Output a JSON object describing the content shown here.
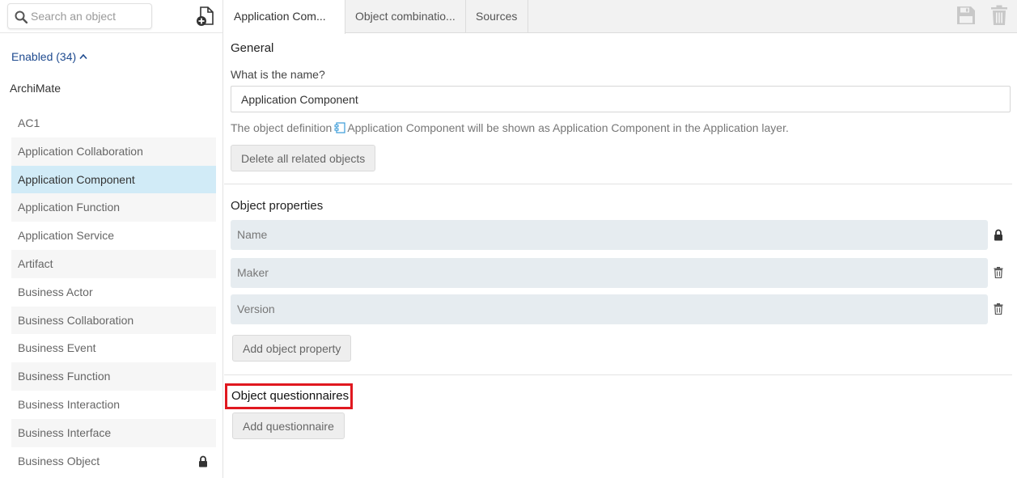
{
  "sidebar": {
    "search_placeholder": "Search an object",
    "enabled_label": "Enabled (34)",
    "group_title": "ArchiMate",
    "items": [
      {
        "label": "AC1"
      },
      {
        "label": "Application Collaboration"
      },
      {
        "label": "Application Component",
        "selected": true
      },
      {
        "label": "Application Function"
      },
      {
        "label": "Application Service"
      },
      {
        "label": "Artifact"
      },
      {
        "label": "Business Actor"
      },
      {
        "label": "Business Collaboration"
      },
      {
        "label": "Business Event"
      },
      {
        "label": "Business Function"
      },
      {
        "label": "Business Interaction"
      },
      {
        "label": "Business Interface"
      },
      {
        "label": "Business Object",
        "locked": true
      }
    ]
  },
  "tabs": [
    {
      "label": "Application Com...",
      "active": true
    },
    {
      "label": "Object combinatio..."
    },
    {
      "label": "Sources"
    }
  ],
  "general": {
    "title": "General",
    "name_question": "What is the name?",
    "name_value": "Application Component",
    "definition_prefix": "The object definition",
    "definition_suffix": "Application Component will be shown as Application Component in the Application layer.",
    "delete_related_label": "Delete all related objects"
  },
  "properties": {
    "title": "Object properties",
    "rows": [
      {
        "label": "Name",
        "icon": "lock-icon"
      },
      {
        "label": "Maker",
        "icon": "trash-icon"
      },
      {
        "label": "Version",
        "icon": "trash-icon"
      }
    ],
    "add_label": "Add object property"
  },
  "questionnaires": {
    "title": "Object questionnaires",
    "add_label": "Add questionnaire"
  },
  "colors": {
    "accent_blue": "#1e4a8f",
    "selected_bg": "#d1ebf7",
    "highlight_red": "#e0181f",
    "property_bg": "#e6ecf0"
  }
}
